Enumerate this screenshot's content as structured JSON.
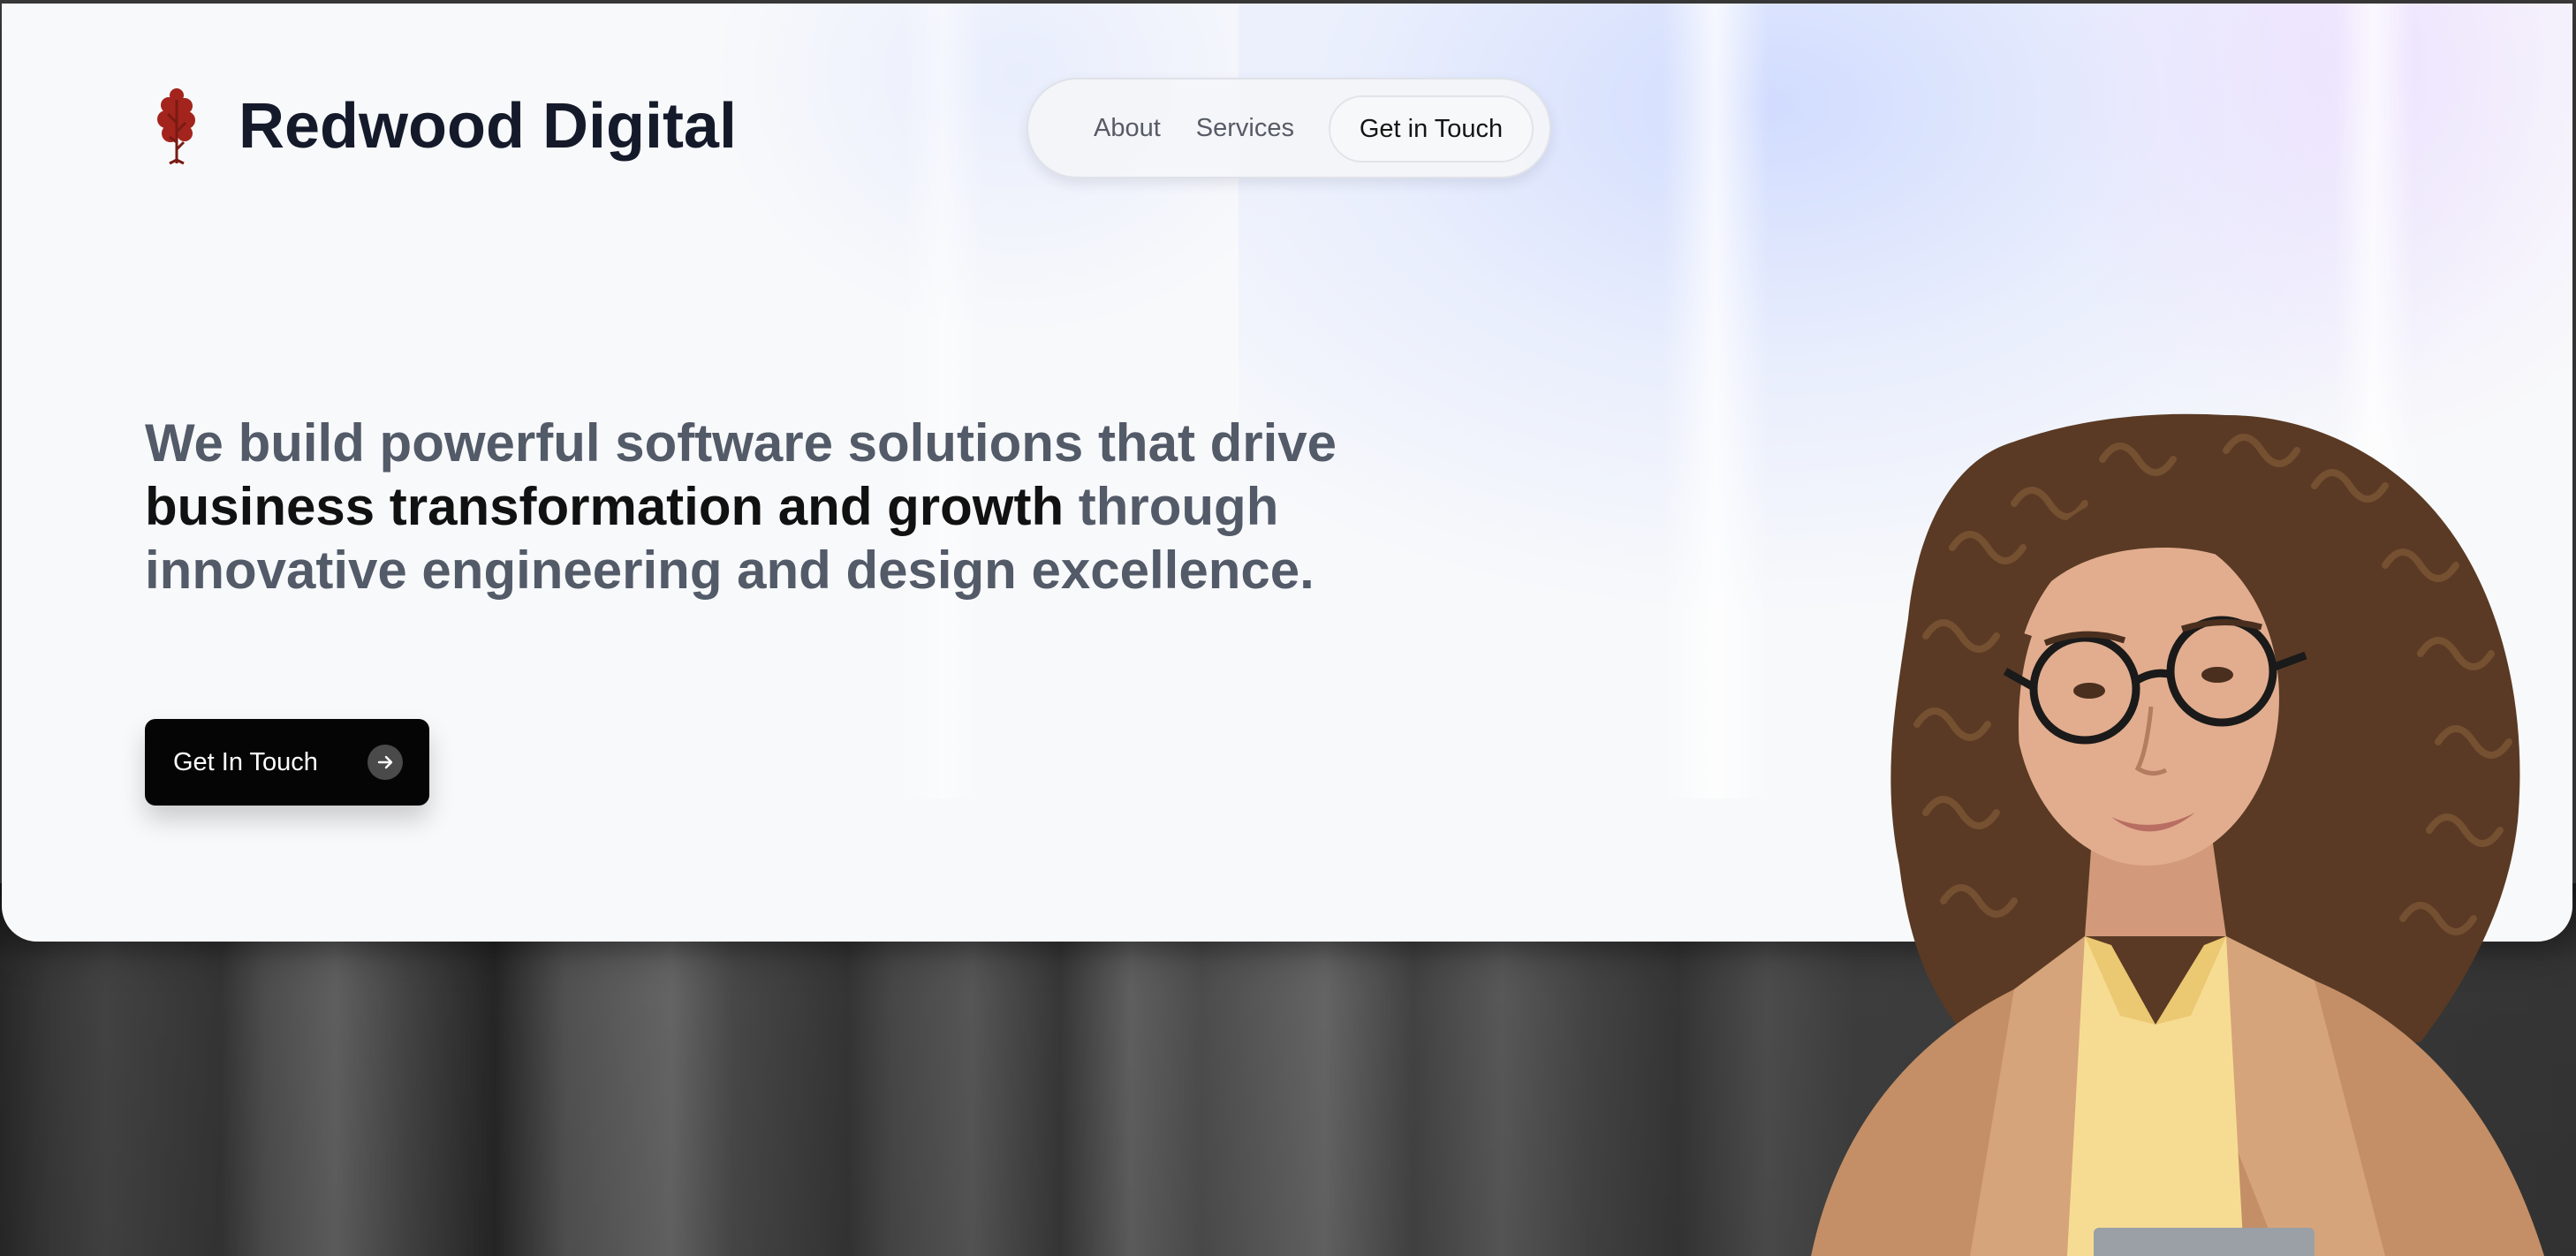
{
  "brand": {
    "name": "Redwood Digital",
    "logo_icon": "redwood-tree-icon",
    "logo_color": "#a3241d"
  },
  "nav": {
    "links": [
      "About",
      "Services"
    ],
    "cta_label": "Get in Touch"
  },
  "hero": {
    "headline_part1": "We build powerful software solutions that drive ",
    "headline_strong": "business transformation and growth",
    "headline_part2": " through innovative engineering and design excellence.",
    "cta_label": "Get In Touch",
    "cta_icon": "arrow-right-icon"
  },
  "colors": {
    "headline_muted": "#535a68",
    "headline_strong": "#111111",
    "cta_background": "#050505",
    "brand_text": "#151a2b"
  }
}
